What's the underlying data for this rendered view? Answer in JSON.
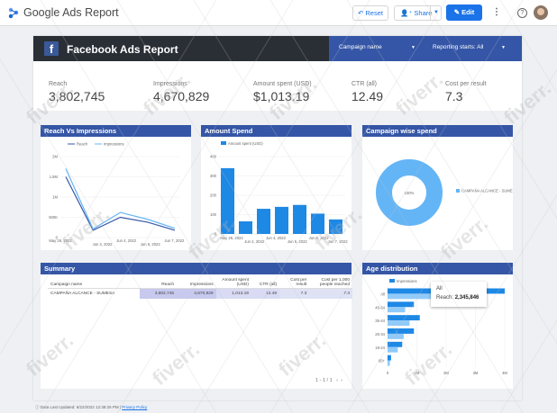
{
  "app": {
    "title": "Google Ads Report",
    "reset_label": "Reset",
    "share_label": "Share",
    "edit_label": "Edit"
  },
  "report": {
    "title": "Facebook Ads Report",
    "campaign_filter_label": "Campaign name",
    "reporting_starts_label": "Reporting starts: All"
  },
  "kpis": [
    {
      "label": "Reach",
      "value": "3,802,745"
    },
    {
      "label": "Impressions",
      "value": "4,670,829"
    },
    {
      "label": "Amount spent (USD)",
      "value": "$1,013.19"
    },
    {
      "label": "CTR (all)",
      "value": "12.49"
    },
    {
      "label": "Cost per result",
      "value": "7.3"
    }
  ],
  "panels": {
    "reach_vs_impressions": "Reach Vs Impressions",
    "amount_spend": "Amount Spend",
    "campaign_wise": "Campaign wise spend",
    "summary": "Summary",
    "age": "Age distribution"
  },
  "summary_table": {
    "headers": [
      "Campaign name",
      "Reach",
      "Impressions",
      "Amount spent (USD)",
      "CTR (all)",
      "Cost per result",
      "Cost per 1,000 people reached"
    ],
    "rows": [
      [
        "CAMPAÑA ALCANCE - SUMESA",
        "3,802,745",
        "4,670,829",
        "1,013.19",
        "12.49",
        "7.3",
        "7.3"
      ]
    ],
    "pager": "1 - 1 / 1"
  },
  "tooltip": {
    "title": "All",
    "label": "Reach:",
    "value": "2,345,846"
  },
  "footer": {
    "updated": "Data Last Updated: 6/22/2022 12:38:26 PM",
    "privacy": "Privacy Policy"
  },
  "watermark": "fiverr.",
  "colors": {
    "brand_blue": "#3556a6",
    "bar_blue": "#1e88e5",
    "light_blue": "#64b5f6",
    "accent": "#1a73e8"
  },
  "chart_data": [
    {
      "type": "line",
      "title": "Reach Vs Impressions",
      "series": [
        {
          "name": "Reach",
          "values": [
            1500000,
            180000,
            500000,
            380000,
            180000
          ]
        },
        {
          "name": "Impressions",
          "values": [
            1700000,
            210000,
            620000,
            450000,
            230000
          ]
        }
      ],
      "x_ticks": [
        "May 26, 2022",
        "Jun 2, 2022",
        "Jun 4, 2022",
        "Jun 6, 2022",
        "Jun 7, 2022"
      ],
      "y_ticks": [
        "2M",
        "1.5M",
        "1M",
        "500K",
        "0"
      ],
      "ylim": [
        0,
        2000000
      ]
    },
    {
      "type": "bar",
      "title": "Amount Spend",
      "series": [
        {
          "name": "Amount spent (USD)",
          "values": [
            340,
            65,
            130,
            140,
            150,
            105,
            75
          ]
        }
      ],
      "x_ticks": [
        "May 26, 2022",
        "Jun 2, 2022",
        "Jun 4, 2022",
        "Jun 5, 2022",
        "Jun 6, 2022",
        "Jun 7, 2022"
      ],
      "y_ticks": [
        "400",
        "300",
        "200",
        "100",
        "0"
      ],
      "ylim": [
        0,
        400
      ]
    },
    {
      "type": "pie",
      "title": "Campaign wise spend",
      "slices": [
        {
          "label": "CAMPAÑA ALCANCE - SUMESA",
          "value": 100,
          "display": "100%"
        }
      ]
    },
    {
      "type": "bar",
      "title": "Age distribution",
      "series": [
        {
          "name": "Impressions",
          "values": [
            4000000,
            900000,
            1100000,
            900000,
            500000,
            120000
          ]
        },
        {
          "name": "Reach",
          "values": [
            2345846,
            600000,
            750000,
            550000,
            350000,
            80000
          ]
        }
      ],
      "categories": [
        "All",
        "45-54",
        "35-44",
        "25-34",
        "18-24",
        "65+"
      ],
      "x_ticks": [
        "0",
        "1M",
        "2M",
        "3M",
        "4M"
      ],
      "xlim": [
        0,
        4000000
      ]
    }
  ]
}
